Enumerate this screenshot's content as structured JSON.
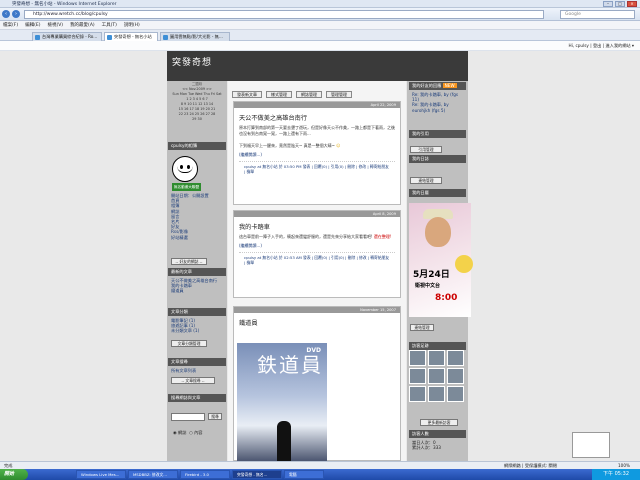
{
  "window": {
    "title": "突發奇想 - 無名小站 - Windows Internet Explorer"
  },
  "address": {
    "url": "http://www.wretch.cc/blog/cpulsy",
    "search_placeholder": "Google"
  },
  "menu": [
    "檔案(F)",
    "編輯(E)",
    "檢視(V)",
    "我的最愛(A)",
    "工具(T)",
    "說明(H)"
  ],
  "tabs": [
    "台灣專業購買綜合紀錄 - Ro...",
    "突發奇想 - 無名小站",
    "圖用雲無點/影/大光影 - 無..."
  ],
  "links_bar": {
    "user": "Hi, cpulsy",
    "logout": "登出",
    "options": "進入我的網站 ▾"
  },
  "blog": {
    "title": "突發奇想"
  },
  "calendar": {
    "head": "二週月",
    "month": "<< Nov.2009 >>",
    "days": "Sun Mon Tue Wed Thu Fri Sat",
    "rows": [
      "1 2 3 4 5 6 7",
      "8 9 10 11 12 13 14",
      "15 16 17 18 19 20 21",
      "22 23 24 25 26 27 28",
      "29 30"
    ]
  },
  "left": {
    "profile_head": "cpulsy的相簿",
    "profile_banner": "無名動畫大聯盟",
    "links1": [
      "開站日期：公開設置",
      "首頁",
      "相簿",
      "網誌",
      "留言",
      "名片",
      "好友",
      "Rss/影像",
      "好站精選"
    ],
    "select1": "-- 好友的網誌 --",
    "recent_head": "最新的文章",
    "recent": [
      "天公不做美之高雄台南行",
      "我的卡踏車",
      "鐵道員"
    ],
    "cat_head": "文章分類",
    "cats": [
      "電影筆記 (1)",
      "旅遊記事 (1)",
      "未分類文章 (1)"
    ],
    "cat_button": "文章分類管理",
    "search_head": "文章搜尋",
    "search_label": "所有文章列表",
    "search_select": "-- 文章搜尋 --",
    "keyword_head": "搜尋網誌與文章",
    "keyword_button": "搜尋",
    "radio1": "網誌",
    "radio2": "內容"
  },
  "toolbar": {
    "b1": "發表新文章",
    "b2": "樣式管理",
    "b3": "網誌管理",
    "b4": "管理管理"
  },
  "posts": [
    {
      "date": "April 22, 2009",
      "title": "天公不做美之高雄台南行",
      "text": "原本打算到南部的第一天要去墾丁遊玩，但是好像天公不作美，一路上都是下著雨，之後也沒有到台南晃一晃，一路上還有下雨...",
      "text2": "下到福天早上一醒來，竟然是陰天~ 真是一整個大晴~",
      "more": "(繼續閱讀...)",
      "meta": "cpulsy at 無名小站 於 03:50 PM 發表 | 回覆(0) | 引用(0) | 刪除 | 修改 | 轉寄給朋友 | 檢舉"
    },
    {
      "date": "April 8, 2009",
      "title": "我的卡踏車",
      "text": "這台車是前一陣子入手的，騎起來還蠻舒服的，還是先來分享給大家看看吧!",
      "text2": "還在整理!",
      "more": "(繼續閱讀...)",
      "meta": "cpulsy at 無名小站 於 02:53 AM 發表 | 回覆(0) | 引用(0) | 刪除 | 修改 | 轉寄給朋友 | 檢舉"
    },
    {
      "date": "November 15, 2007",
      "title": "鐵道員",
      "dvd_title": "鉄道員",
      "dvd_logo": "DVD"
    }
  ],
  "right": {
    "h1": "我的好友的回應",
    "h1_badge": "NEW",
    "replies": [
      "Re: 我的卡踏車, by (fgs 11)",
      "Re: 我的卡踏車, by eurohjkh (fgs 5)"
    ],
    "h2": "我的引用",
    "b2": "引用管理",
    "h3": "我的日誌",
    "b3": "連結管理",
    "h4": "我的日曆",
    "ad_big": "5月24日",
    "ad_sub": "衛視中文台",
    "ad_time": "8:00",
    "b4": "連結管理",
    "h5": "訪客足跡",
    "b5": "更多最新訪客",
    "h6": "訪客人數",
    "count1": "當日人次：0",
    "count2": "累計人次：333"
  },
  "status": {
    "left": "完成",
    "right": "網際網路 | 受保護模式: 關閉",
    "zoom": "100%"
  },
  "taskbar": {
    "start": "開始",
    "tasks": [
      "Windows Live Mes...",
      "MSDBBZ: 修改文...",
      "Firebird - 3.0",
      "突發奇想 - 無名...",
      "電腦"
    ],
    "clock": "下午 05:32"
  }
}
